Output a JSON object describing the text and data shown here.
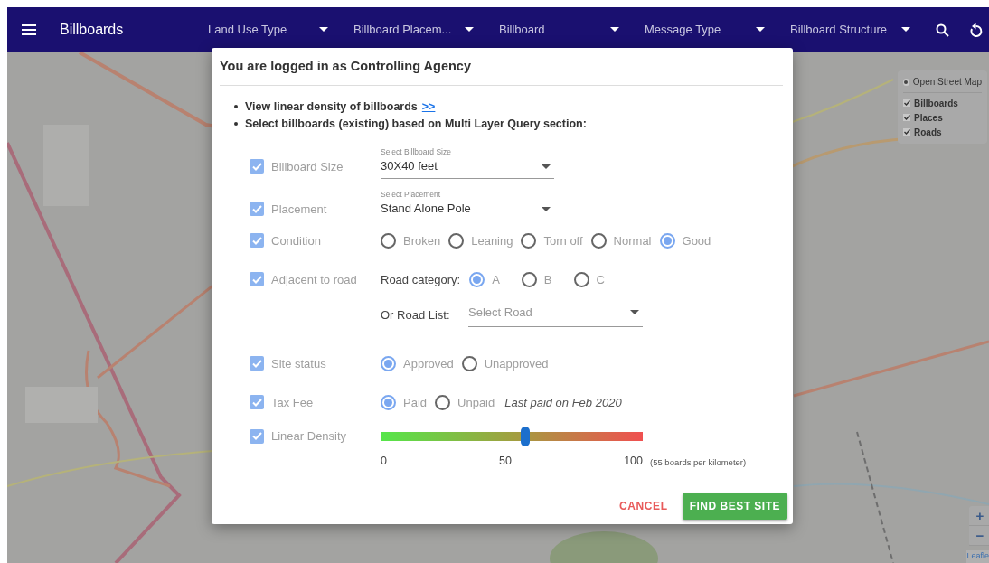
{
  "app_bar": {
    "title": "Billboards",
    "filters": [
      {
        "label": "Land Use Type"
      },
      {
        "label": "Billboard Placem..."
      },
      {
        "label": "Billboard"
      },
      {
        "label": "Message Type"
      },
      {
        "label": "Billboard Structure"
      }
    ]
  },
  "map": {
    "base_layers": [
      {
        "label": "Open Street Map",
        "selected": true
      }
    ],
    "overlays": [
      {
        "label": "Billboards",
        "checked": true
      },
      {
        "label": "Places",
        "checked": true
      },
      {
        "label": "Roads",
        "checked": true
      }
    ],
    "zoom_controls": [
      "+",
      "−"
    ],
    "attribution": "Leafle"
  },
  "dialog": {
    "title": "You are logged in as Controlling Agency",
    "bullets": [
      {
        "text": "View linear density of billboards",
        "link": ">>"
      },
      {
        "text": "Select billboards (existing) based on Multi Layer Query section:"
      }
    ],
    "criteria": [
      {
        "kind": "select",
        "label": "Billboard Size",
        "checked": true,
        "caption": "Select Billboard Size",
        "value": "30X40 feet"
      },
      {
        "kind": "select",
        "label": "Placement",
        "checked": true,
        "caption": "Select Placement",
        "value": "Stand Alone Pole"
      },
      {
        "kind": "radio",
        "label": "Condition",
        "checked": true,
        "options": [
          {
            "label": "Broken",
            "selected": false
          },
          {
            "label": "Leaning",
            "selected": false
          },
          {
            "label": "Torn off",
            "selected": false
          },
          {
            "label": "Normal",
            "selected": false
          },
          {
            "label": "Good",
            "selected": true
          }
        ]
      },
      {
        "kind": "road",
        "label": "Adjacent to road",
        "checked": true,
        "category_label": "Road category:",
        "options": [
          {
            "label": "A",
            "selected": true
          },
          {
            "label": "B",
            "selected": false
          },
          {
            "label": "C",
            "selected": false
          }
        ],
        "list_label": "Or Road List:",
        "list_placeholder": "Select Road"
      },
      {
        "kind": "radio",
        "label": "Site status",
        "checked": true,
        "options": [
          {
            "label": "Approved",
            "selected": true
          },
          {
            "label": "Unapproved",
            "selected": false
          }
        ]
      },
      {
        "kind": "radio",
        "label": "Tax Fee",
        "checked": true,
        "options": [
          {
            "label": "Paid",
            "selected": true
          },
          {
            "label": "Unpaid",
            "selected": false
          }
        ],
        "note": "Last paid on Feb 2020"
      },
      {
        "kind": "slider",
        "label": "Linear Density",
        "checked": true,
        "level": 0.55,
        "ticks": [
          "0",
          "50",
          "100"
        ],
        "reading": "(55 boards per kilometer)"
      }
    ],
    "buttons": [
      {
        "kind": "text",
        "label": "CANCEL"
      },
      {
        "kind": "primary",
        "label": "FIND BEST SITE"
      }
    ]
  }
}
